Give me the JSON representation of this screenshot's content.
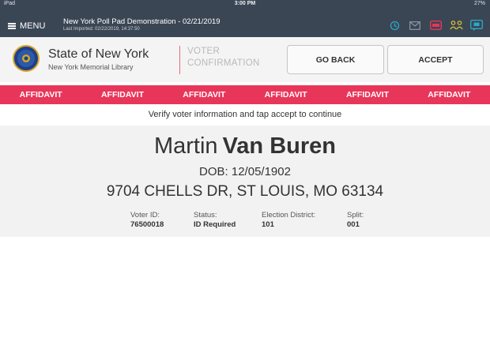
{
  "status_bar": {
    "carrier": "iPad",
    "time": "3:00 PM",
    "battery": "27%"
  },
  "topbar": {
    "menu_label": "MENU",
    "title": "New York Poll Pad Demonstration - 02/21/2019",
    "last_imported": "Last Imported: 02/22/2019, 14:37:50",
    "icons": [
      "history-icon",
      "mail-icon",
      "card-icon",
      "voters-icon",
      "chat-icon"
    ],
    "colors": {
      "bar": "#3b4655",
      "history": "#2aa8c9",
      "card": "#e8365a",
      "voters": "#e6c72a",
      "chat": "#2aa8c9"
    }
  },
  "header": {
    "org_name": "State of New York",
    "org_sub": "New York Memorial Library",
    "screen_title": "VOTER CONFIRMATION",
    "go_back_label": "GO BACK",
    "accept_label": "ACCEPT"
  },
  "affidavit_bar": {
    "color": "#e8365a",
    "items": [
      "AFFIDAVIT",
      "AFFIDAVIT",
      "AFFIDAVIT",
      "AFFIDAVIT",
      "AFFIDAVIT",
      "AFFIDAVIT"
    ]
  },
  "instruction": "Verify voter information and tap accept to continue",
  "voter": {
    "first_name": "Martin",
    "last_name": "Van Buren",
    "dob": "DOB: 12/05/1902",
    "address": "9704 CHELLS DR, ST LOUIS, MO 63134",
    "fields": [
      {
        "label": "Voter ID:",
        "value": "76500018"
      },
      {
        "label": "Status:",
        "value": "ID Required"
      },
      {
        "label": "Election District:",
        "value": "101"
      },
      {
        "label": "Split:",
        "value": "001"
      }
    ]
  }
}
